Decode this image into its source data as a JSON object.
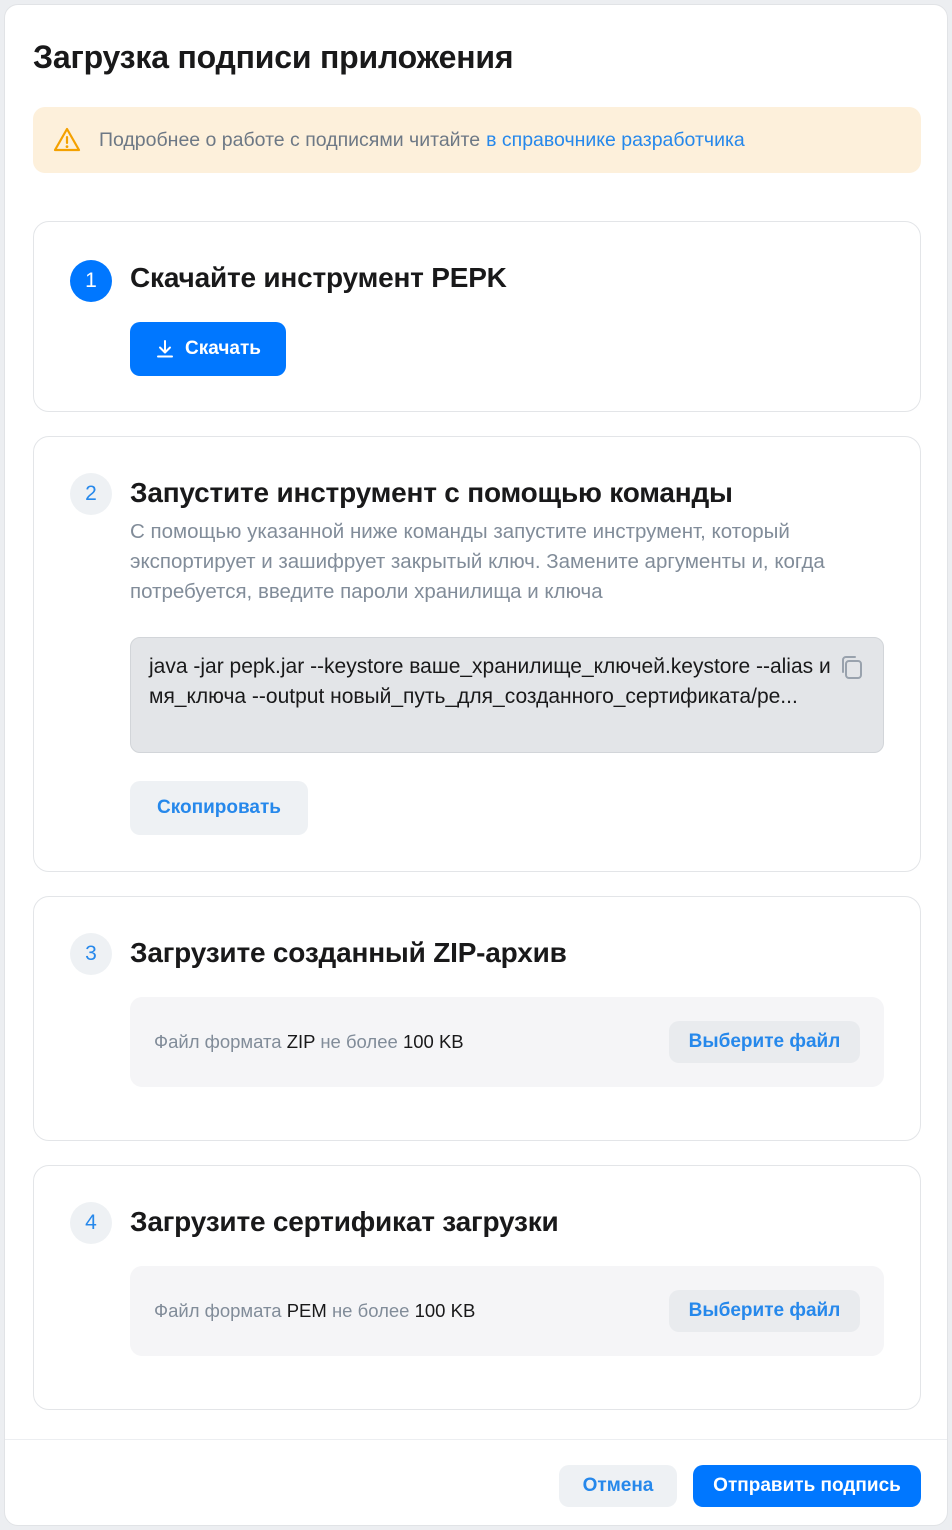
{
  "dialog": {
    "title": "Загрузка подписи приложения",
    "alert": {
      "text": "Подробнее о работе с подписями читайте",
      "link": "в справочнике разработчика",
      "icon": "warning-triangle-icon"
    }
  },
  "steps": [
    {
      "number": "1",
      "title": "Скачайте инструмент PEPK",
      "button": "Скачать",
      "button_icon": "download-icon"
    },
    {
      "number": "2",
      "title": "Запустите инструмент с помощью команды",
      "description": "С помощью указанной ниже команды запустите инструмент, который экспортирует и зашифрует закрытый ключ. Замените аргументы и, когда потребуется, введите пароли хранилища и ключа",
      "command": "java -jar pepk.jar --keystore ваше_хранилище_ключей.keystore --alias имя_ключа --output новый_путь_для_созданного_сертификата/pe...",
      "copy_button": "Скопировать"
    },
    {
      "number": "3",
      "title": "Загрузите созданный ZIP-архив",
      "file_prefix": "Файл формата",
      "file_format": "ZIP",
      "file_middle": "не более",
      "file_size": "100 KB",
      "choose_button": "Выберите файл"
    },
    {
      "number": "4",
      "title": "Загрузите сертификат загрузки",
      "file_prefix": "Файл формата",
      "file_format": "PEM",
      "file_middle": "не более",
      "file_size": "100 KB",
      "choose_button": "Выберите файл"
    }
  ],
  "footer": {
    "cancel": "Отмена",
    "submit": "Отправить подпись"
  },
  "colors": {
    "accent": "#0077ff",
    "link": "#2688eb",
    "alert_bg": "#fdf0db",
    "warning": "#f4a100"
  }
}
